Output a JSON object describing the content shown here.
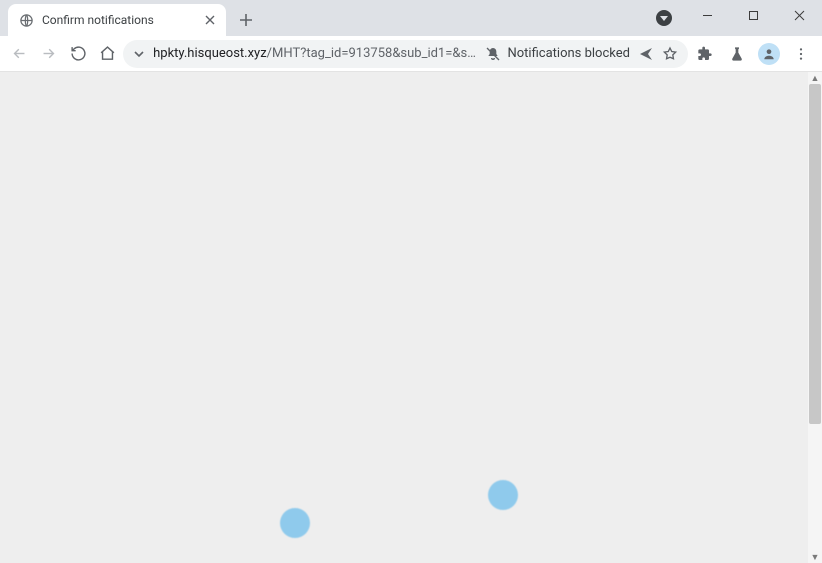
{
  "titlebar": {
    "tab_title": "Confirm notifications"
  },
  "toolbar": {
    "url_host": "hpkty.hisqueost.xyz",
    "url_path": "/MHT?tag_id=913758&sub_id1=&sub_id2=1...",
    "notification_chip_label": "Notifications blocked"
  },
  "colors": {
    "tabstrip_bg": "#dee1e6",
    "page_bg": "#eeeeee",
    "loading_dot": "#8fcaec"
  }
}
